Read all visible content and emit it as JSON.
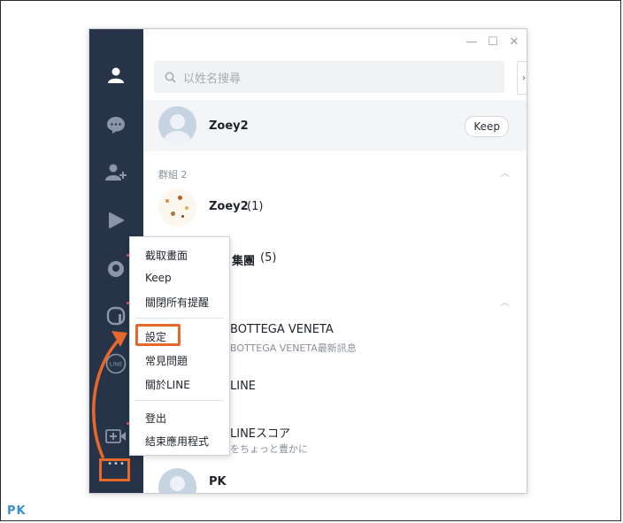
{
  "window": {
    "controls": [
      "—",
      "☐",
      "✕"
    ]
  },
  "sidebar": {
    "items": [
      "profile-icon",
      "chat-icon",
      "add-friend-icon",
      "play-icon",
      "timeline-icon",
      "openchat-icon",
      "line-today-icon",
      "video-call-icon"
    ],
    "line_badge": "LINE",
    "more": "•••"
  },
  "search": {
    "placeholder": "以姓名搜尋"
  },
  "side_toggle": "›",
  "profile": {
    "name": "Zoey2",
    "keep_label": "Keep"
  },
  "groups_section": {
    "label": "群組 2",
    "items": [
      {
        "name": "Zoey2",
        "count": "(1)"
      },
      {
        "name": "集團",
        "count": "(5)"
      }
    ]
  },
  "friends": [
    {
      "name": "BOTTEGA VENETA",
      "status": "BOTTEGA VENETA最新訊息"
    },
    {
      "name": "LINE",
      "status": ""
    },
    {
      "name": "LINEスコア",
      "status": "をちょっと豊かに"
    },
    {
      "name": "PK",
      "status": ""
    }
  ],
  "context_menu": {
    "items": [
      "截取畫面",
      "Keep",
      "關閉所有提醒",
      "設定",
      "常見問題",
      "關於LINE",
      "登出",
      "結束應用程式"
    ]
  },
  "watermark": "PK",
  "colors": {
    "sidebar": "#263348",
    "highlight": "#e8682c",
    "profile_row": "#f4f5f7"
  }
}
